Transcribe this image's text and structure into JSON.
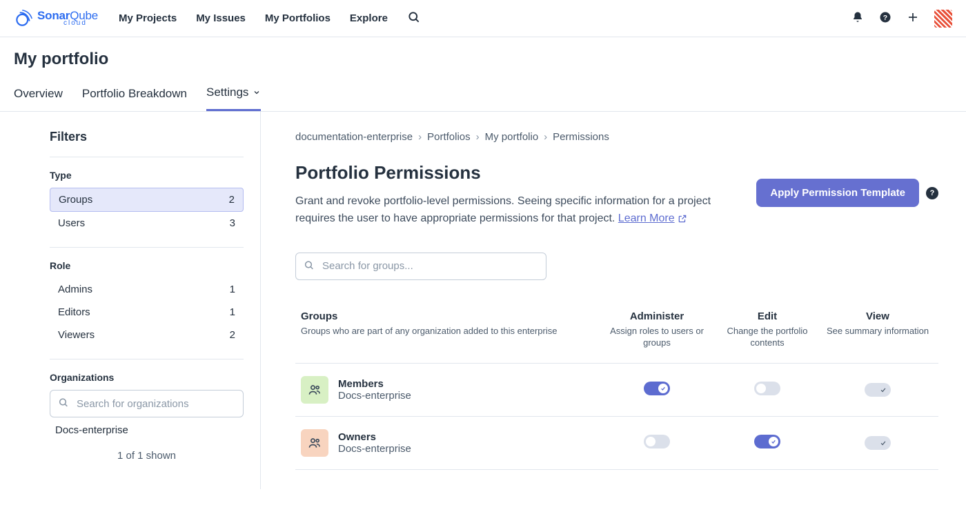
{
  "nav": {
    "brand_primary": "Sonar",
    "brand_secondary": "Qube",
    "brand_sub": "cloud",
    "items": [
      "My Projects",
      "My Issues",
      "My Portfolios",
      "Explore"
    ]
  },
  "page": {
    "title": "My portfolio",
    "tabs": {
      "overview": "Overview",
      "breakdown": "Portfolio Breakdown",
      "settings": "Settings"
    }
  },
  "sidebar": {
    "heading": "Filters",
    "type_label": "Type",
    "type_items": [
      {
        "label": "Groups",
        "count": "2"
      },
      {
        "label": "Users",
        "count": "3"
      }
    ],
    "role_label": "Role",
    "role_items": [
      {
        "label": "Admins",
        "count": "1"
      },
      {
        "label": "Editors",
        "count": "1"
      },
      {
        "label": "Viewers",
        "count": "2"
      }
    ],
    "orgs_label": "Organizations",
    "org_search_placeholder": "Search for organizations",
    "org_item": "Docs-enterprise",
    "shown": "1 of 1 shown"
  },
  "breadcrumb": [
    "documentation-enterprise",
    "Portfolios",
    "My portfolio",
    "Permissions"
  ],
  "main": {
    "title": "Portfolio Permissions",
    "apply_label": "Apply Permission Template",
    "desc": "Grant and revoke portfolio-level permissions. Seeing specific information for a project requires the user to have appropriate permissions for that project. ",
    "learn_more": "Learn More",
    "search_placeholder": "Search for groups..."
  },
  "table": {
    "group_head": "Groups",
    "group_sub": "Groups who are part of any organization added to this enterprise",
    "cols": [
      {
        "title": "Administer",
        "sub": "Assign roles to users or groups"
      },
      {
        "title": "Edit",
        "sub": "Change the portfolio contents"
      },
      {
        "title": "View",
        "sub": "See summary information"
      }
    ],
    "rows": [
      {
        "name": "Members",
        "org": "Docs-enterprise",
        "avatar": "green",
        "admin": true,
        "edit": false
      },
      {
        "name": "Owners",
        "org": "Docs-enterprise",
        "avatar": "orange",
        "admin": false,
        "edit": true
      }
    ]
  }
}
